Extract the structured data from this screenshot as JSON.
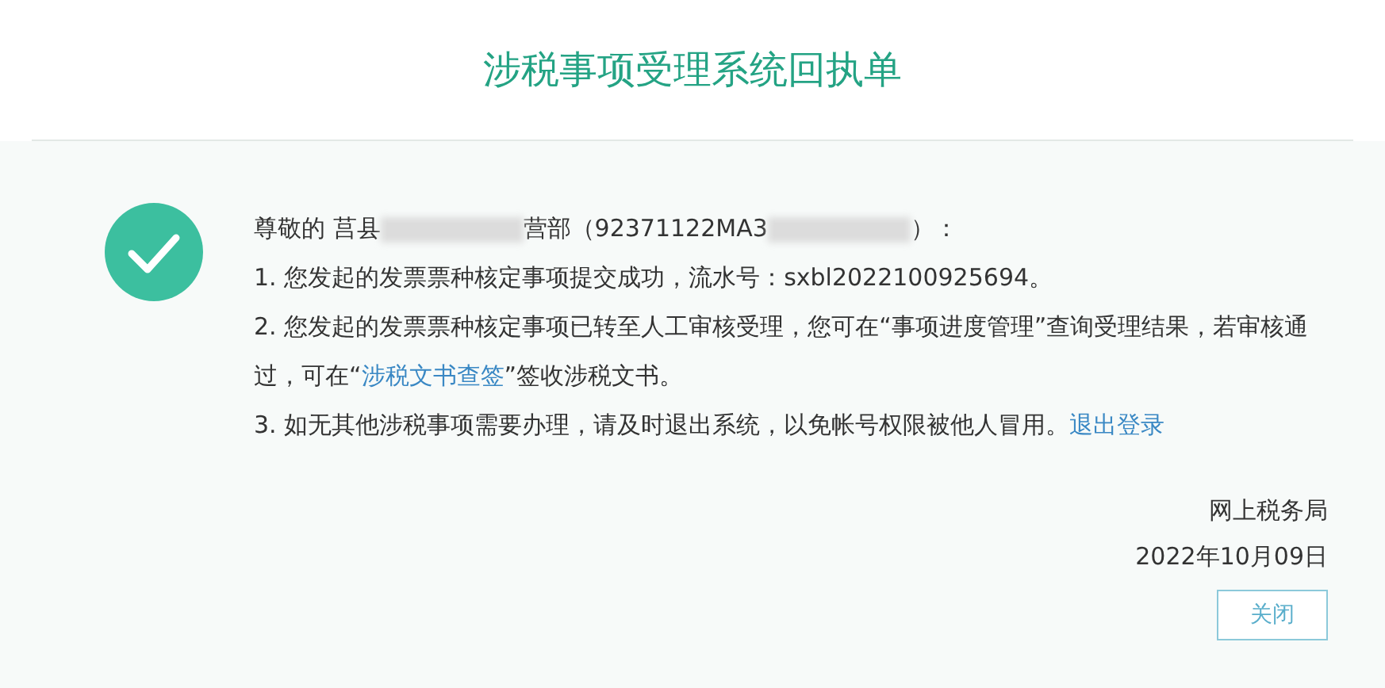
{
  "title": "涉税事项受理系统回执单",
  "greeting": [
    {
      "kind": "text",
      "text": "尊敬的 莒县"
    },
    {
      "kind": "redacted"
    },
    {
      "kind": "text",
      "text": "营部（92371122MA3"
    },
    {
      "kind": "redacted"
    },
    {
      "kind": "text",
      "text": "）："
    }
  ],
  "items": [
    [
      {
        "kind": "text",
        "text": "1. 您发起的发票票种核定事项提交成功，流水号：sxbl2022100925694。"
      }
    ],
    [
      {
        "kind": "text",
        "text": "2. 您发起的发票票种核定事项已转至人工审核受理，您可在“事项进度管理”查询受理结果，若审核通过，可在“"
      },
      {
        "kind": "link",
        "text": "涉税文书查签"
      },
      {
        "kind": "text",
        "text": "”签收涉税文书。"
      }
    ],
    [
      {
        "kind": "text",
        "text": "3. 如无其他涉税事项需要办理，请及时退出系统，以免帐号权限被他人冒用。"
      },
      {
        "kind": "link",
        "text": "退出登录"
      }
    ]
  ],
  "signature": "网上税务局",
  "date": "2022年10月09日",
  "close_button": "关闭"
}
